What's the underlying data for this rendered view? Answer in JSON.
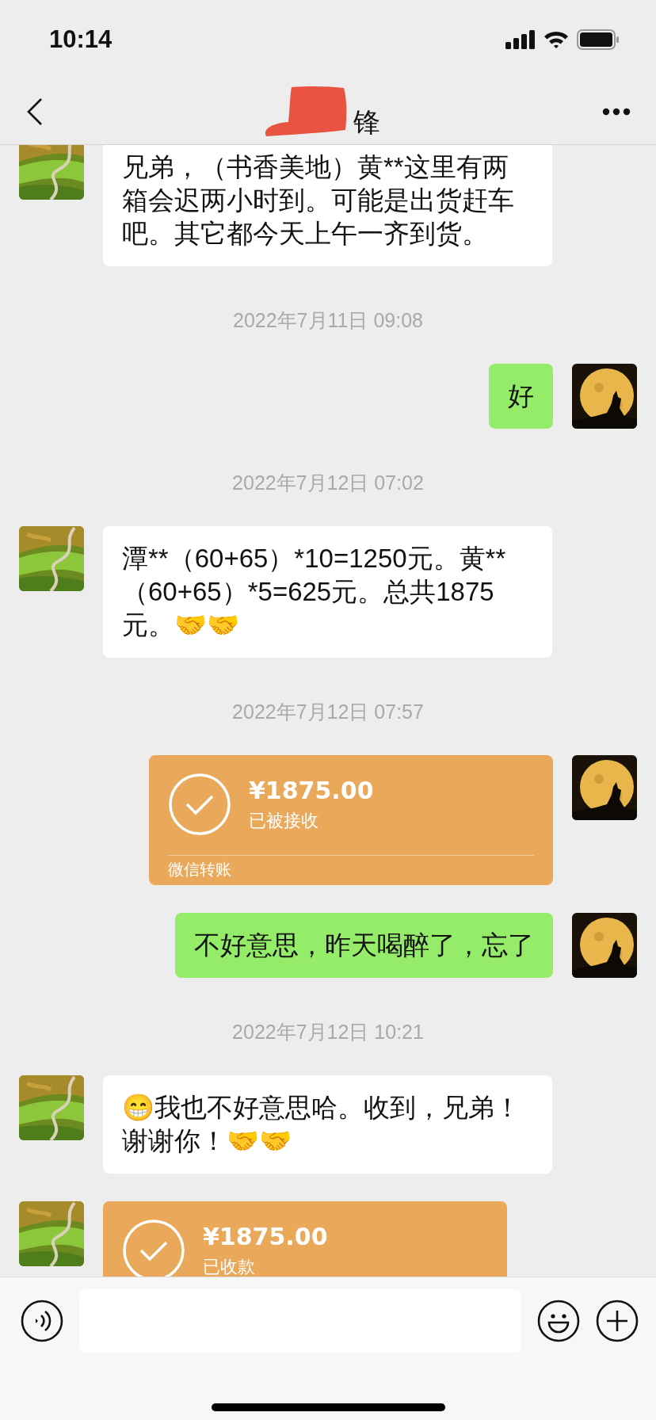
{
  "status_bar": {
    "time": "10:14"
  },
  "nav": {
    "title": "锋",
    "redacted": true
  },
  "messages": [
    {
      "kind": "text",
      "outgoing": false,
      "text": "兄弟，（书香美地）黄**这里有两箱会迟两小时到。可能是出货赶车吧。其它都今天上午一齐到货。"
    },
    {
      "kind": "time",
      "text": "2022年7月11日 09:08"
    },
    {
      "kind": "text",
      "outgoing": true,
      "text": "好"
    },
    {
      "kind": "time",
      "text": "2022年7月12日 07:02"
    },
    {
      "kind": "text",
      "outgoing": false,
      "text": "潭**（60+65）*10=1250元。黄**（60+65）*5=625元。总共1875元。🤝🤝"
    },
    {
      "kind": "time",
      "text": "2022年7月12日 07:57"
    },
    {
      "kind": "transfer",
      "outgoing": true,
      "amount": "¥1875.00",
      "status": "已被接收",
      "footer": "微信转账"
    },
    {
      "kind": "text",
      "outgoing": true,
      "text": "不好意思，昨天喝醉了，忘了"
    },
    {
      "kind": "time",
      "text": "2022年7月12日 10:21"
    },
    {
      "kind": "text",
      "outgoing": false,
      "text": "😁我也不好意思哈。收到，兄弟！谢谢你！🤝🤝"
    },
    {
      "kind": "transfer",
      "outgoing": false,
      "amount": "¥1875.00",
      "status": "已收款"
    }
  ]
}
